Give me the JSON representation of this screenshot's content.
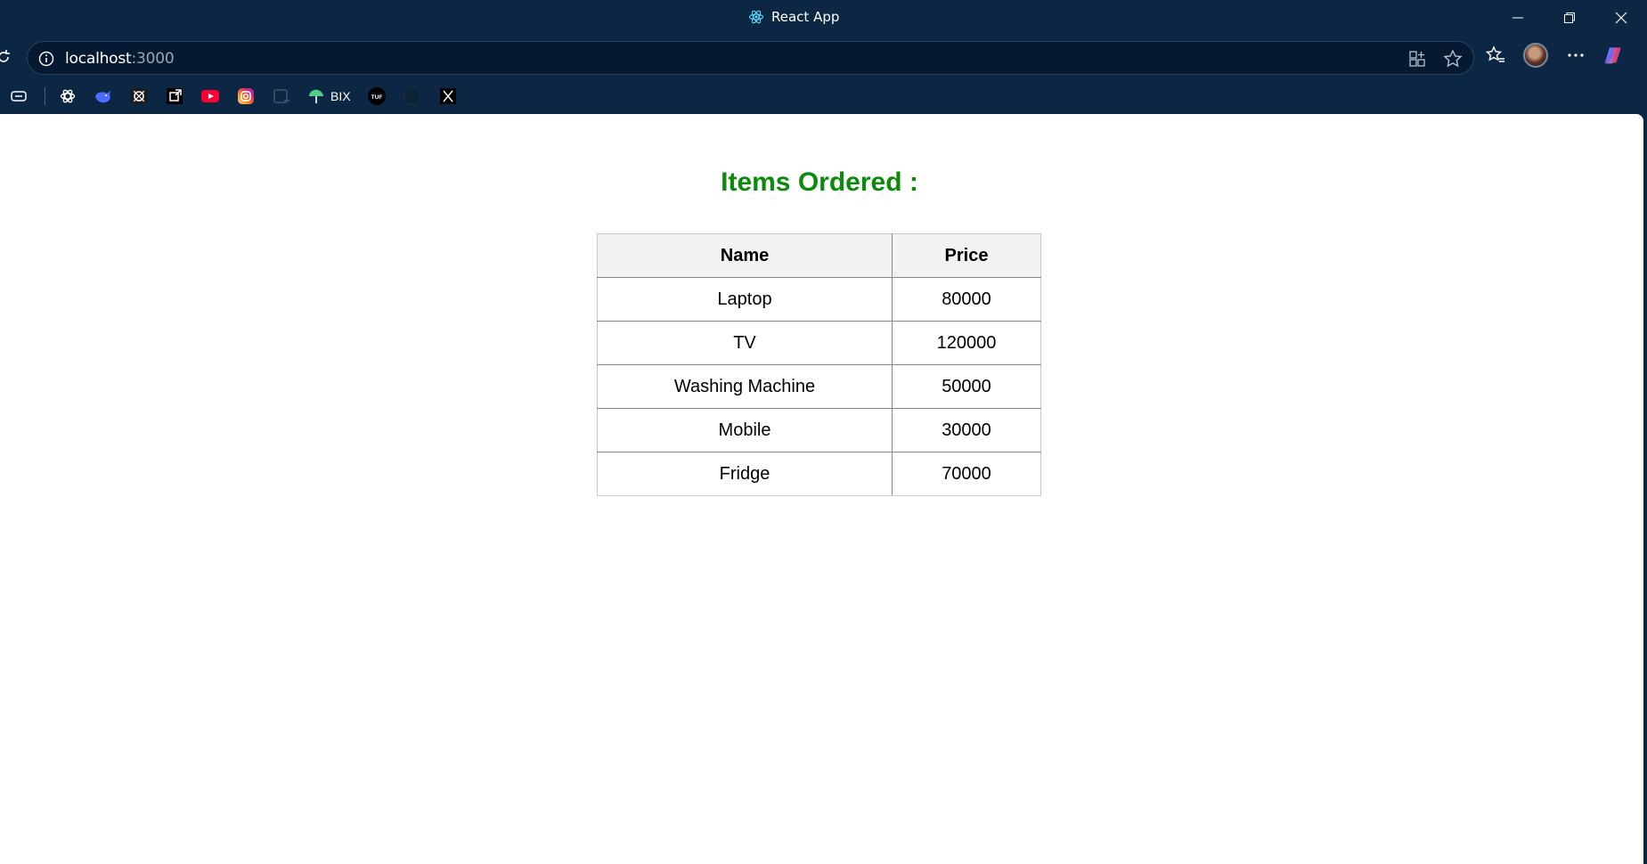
{
  "window": {
    "title": "React App"
  },
  "address_bar": {
    "host": "localhost",
    "port": ":3000"
  },
  "bookmarks": [
    {
      "name": "chatgpt",
      "label": ""
    },
    {
      "name": "deepseek",
      "label": ""
    },
    {
      "name": "bookmark-3",
      "label": ""
    },
    {
      "name": "bookmark-4",
      "label": ""
    },
    {
      "name": "youtube",
      "label": ""
    },
    {
      "name": "instagram",
      "label": ""
    },
    {
      "name": "bookmark-7",
      "label": ""
    },
    {
      "name": "bix",
      "label": "BIX"
    },
    {
      "name": "tuf",
      "label": "TUF"
    },
    {
      "name": "github",
      "label": ""
    },
    {
      "name": "x",
      "label": ""
    }
  ],
  "page": {
    "heading": "Items Ordered :",
    "table": {
      "headers": [
        "Name",
        "Price"
      ],
      "rows": [
        [
          "Laptop",
          "80000"
        ],
        [
          "TV",
          "120000"
        ],
        [
          "Washing Machine",
          "50000"
        ],
        [
          "Mobile",
          "30000"
        ],
        [
          "Fridge",
          "70000"
        ]
      ]
    }
  }
}
